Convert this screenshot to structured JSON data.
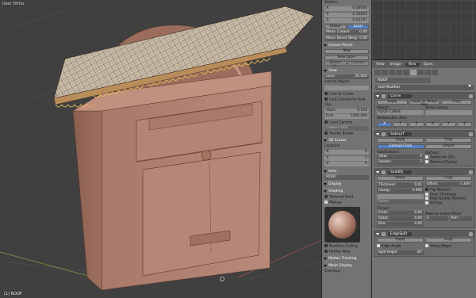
{
  "viewport": {
    "view_label": "User Ortho",
    "object_label": "(1) ROOF"
  },
  "npanel": {
    "median_label": "Median:",
    "median": [
      {
        "axis": "X:",
        "value": "-0.00000"
      },
      {
        "axis": "Y:",
        "value": "-0.30855"
      },
      {
        "axis": "Z:",
        "value": "-0.02597"
      }
    ],
    "global_label": "Global",
    "local_label": "Local",
    "mean_crease": {
      "label": "Mean Crease:",
      "value": "0.00"
    },
    "mean_bevel": {
      "label": "Mean Bevel Weig:",
      "value": "0.00"
    },
    "grease_pencil": "Grease Pencil",
    "new_label": "New",
    "new_layer_label": "New Layer",
    "delete_frame_label": "Delete Fra...",
    "convert_label": "Convert",
    "view_header": "View",
    "lens": {
      "label": "Lens:",
      "value": "35.000"
    },
    "lock_to_object": "Lock to Object:",
    "lock_to_cursor": "Lock to Cursor",
    "lock_camera": "Lock Camera to View",
    "clip_label": "Clip:",
    "clip_start": {
      "label": "Start:",
      "value": "0.100"
    },
    "clip_end": {
      "label": "End:",
      "value": "1000.000"
    },
    "local_camera": "Local Camera",
    "camera_field": "Camera.001",
    "render_border": "Render Border",
    "cursor_header": "3D Cursor",
    "location_label": "Location:",
    "cursor": [
      {
        "axis": "X:",
        "value": "0"
      },
      {
        "axis": "Y:",
        "value": "0"
      },
      {
        "axis": "Z:",
        "value": "0"
      }
    ],
    "item_header": "Item",
    "item_name": "ROOF",
    "display_header": "Display",
    "shading_header": "Shading",
    "textured_solid": "Textured Solid",
    "matcap": "Matcap",
    "backface_culling": "Backface Culling",
    "hidden_wire": "Hidden Wire",
    "motion_tracking": "Motion Tracking",
    "mesh_display": "Mesh Display",
    "overlays": "Overlays:"
  },
  "right": {
    "header": {
      "view": "View",
      "image": "Image",
      "new": "New",
      "open": "Open"
    },
    "object_name": "ROOF",
    "add_modifier": "Add Modifier",
    "curve": {
      "name": "Curve",
      "apply": "Apply",
      "apply_shape": "Apply as Shape Key",
      "copy": "Copy",
      "object_label": "Object:",
      "object_value": "ROOF CURVE",
      "vertex_group_label": "Vertex Group:",
      "deform_axis_label": "Deformation Axis:",
      "axes": [
        "X",
        "Y",
        "Z",
        "-X",
        "-Y",
        "-Z"
      ]
    },
    "subsurf": {
      "name": "Subsurf",
      "apply": "Apply",
      "copy": "Copy",
      "catmull": "Catmull-Clark",
      "simple": "Simple",
      "subdivisions_label": "Subdivisions:",
      "view": {
        "label": "View:",
        "value": "2"
      },
      "render": {
        "label": "Render:",
        "value": "2"
      },
      "options_label": "Options:",
      "subdivide_uvs": "Subdivide UVs",
      "optimal_display": "Optimal Display"
    },
    "solidify": {
      "name": "Solidify",
      "apply": "Apply",
      "copy": "Copy",
      "thickness": {
        "label": "Thickness:",
        "value": "0.01"
      },
      "offset": {
        "label": "Offset:",
        "value": "-1.000"
      },
      "clamp": {
        "label": "Clamp:",
        "value": "0.000"
      },
      "flip_normals": "Flip Normals",
      "even_thickness": "Even Thickness",
      "high_quality_normals": "High Quality Normals",
      "fill_rim": "Fill Rim",
      "factor": "Factor:",
      "crease_label": "Crease:",
      "inner": {
        "label": "Inner:",
        "value": "0.00"
      },
      "outer": {
        "label": "Outer:",
        "value": "0.00"
      },
      "rim": {
        "label": "Rim:",
        "value": "0.00"
      },
      "material_offset_label": "Material Index Offset:",
      "mat_value": "0",
      "rim_value": "Rim:"
    },
    "edgesplit": {
      "name": "EdgeSplit",
      "apply": "Apply",
      "copy": "Copy",
      "edge_angle": "Edge Angle",
      "sharp_edges": "Sharp Edges",
      "split_angle": {
        "label": "Split Angle:",
        "value": "30°"
      }
    }
  },
  "colors": {
    "accent_blue": "#5680c2",
    "model": "#b38473",
    "roof": "#cfc4b0"
  }
}
